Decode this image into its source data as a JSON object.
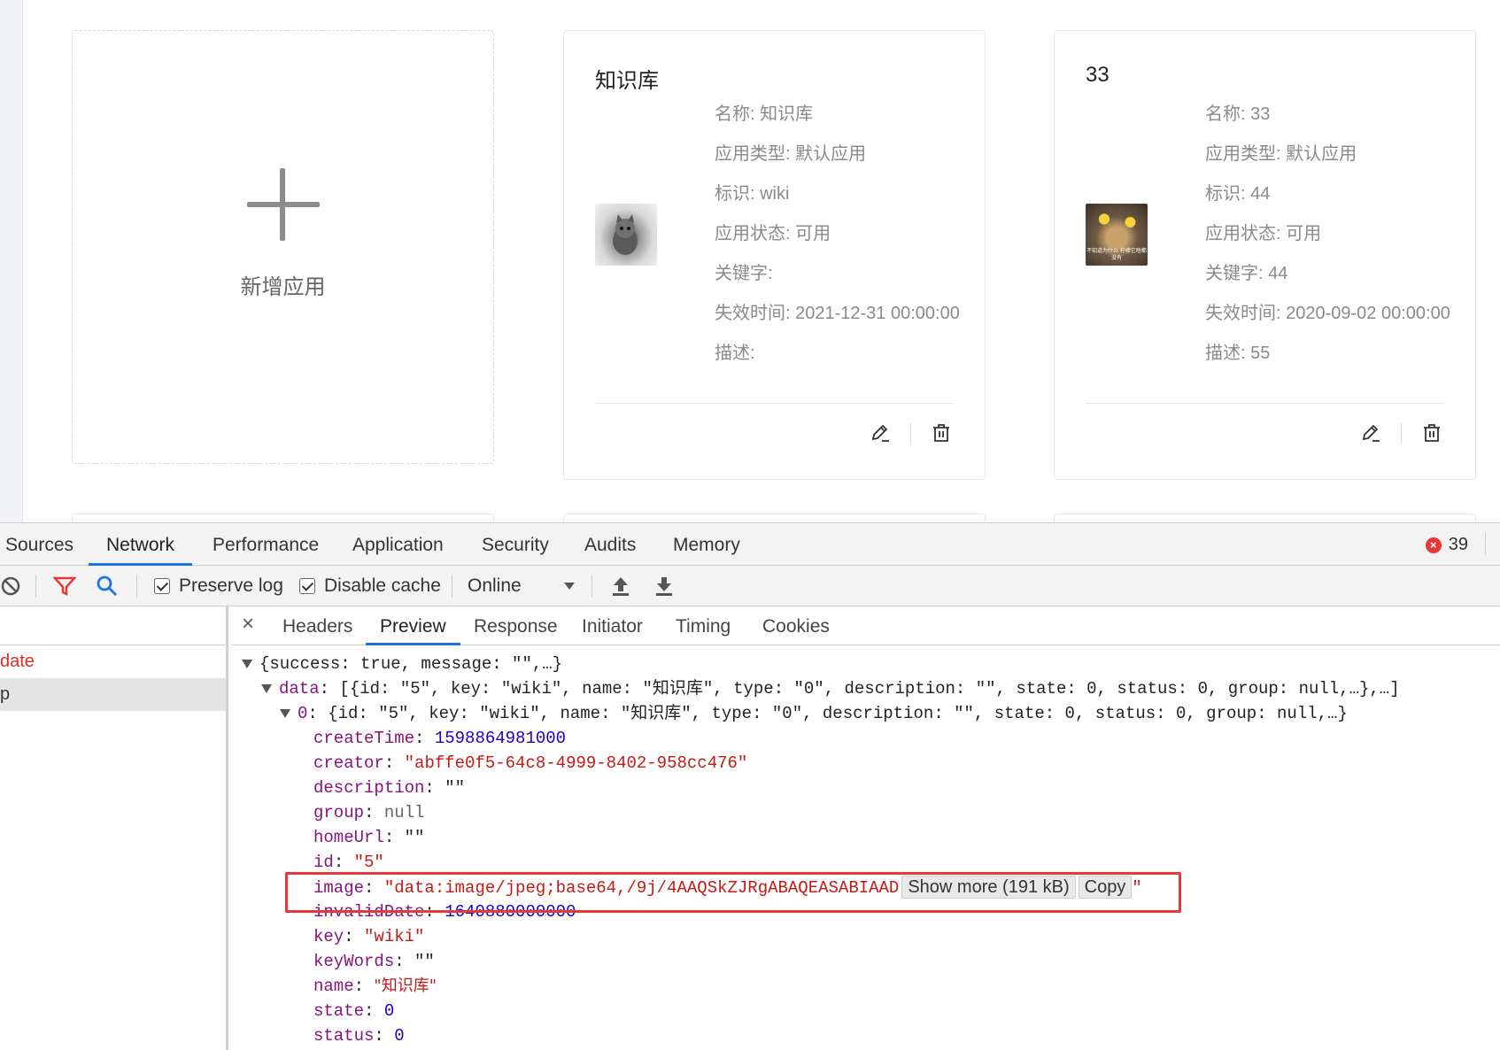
{
  "app": {
    "add_card": {
      "label": "新增应用"
    },
    "cards": [
      {
        "title": "知识库",
        "name": "名称: 知识库",
        "type": "应用类型: 默认应用",
        "key": "标识: wiki",
        "state": "应用状态: 可用",
        "keywords": "关键字:",
        "invalid_date": "失效时间: 2021-12-31 00:00:00",
        "description": "描述:",
        "image_icon": "kitten-photo"
      },
      {
        "title": "33",
        "name": "名称: 33",
        "type": "应用类型: 默认应用",
        "key": "标识: 44",
        "state": "应用状态: 可用",
        "keywords": "关键字: 44",
        "invalid_date": "失效时间: 2020-09-02 00:00:00",
        "description": "描述: 55",
        "image_icon": "meme-photo",
        "image_caption": "不知道为什么 柠檬它啥都没有"
      }
    ]
  },
  "devtools": {
    "tabs": [
      "Sources",
      "Network",
      "Performance",
      "Application",
      "Security",
      "Audits",
      "Memory"
    ],
    "active_tab": "Network",
    "error_count": "39",
    "toolbar": {
      "preserve_log": "Preserve log",
      "disable_cache": "Disable cache",
      "throttling": "Online"
    },
    "requests": [
      {
        "name": "date"
      },
      {
        "name": "p"
      }
    ],
    "detail_tabs": [
      "Headers",
      "Preview",
      "Response",
      "Initiator",
      "Timing",
      "Cookies"
    ],
    "active_detail_tab": "Preview",
    "preview": {
      "root": "{success: true, message: \"\",…}",
      "data_key": "data",
      "data_summary": "[{id: \"5\", key: \"wiki\", name: \"知识库\", type: \"0\", description: \"\", state: 0, status: 0, group: null,…},…]",
      "item_key": "0",
      "item_summary": "{id: \"5\", key: \"wiki\", name: \"知识库\", type: \"0\", description: \"\", state: 0, status: 0, group: null,…}",
      "fields": [
        {
          "key": "createTime",
          "value": "1598864981000",
          "kind": "number"
        },
        {
          "key": "creator",
          "value": "\"abffe0f5-64c8-4999-8402-958cc476\"",
          "kind": "string"
        },
        {
          "key": "description",
          "value": "\"\"",
          "kind": "plain"
        },
        {
          "key": "group",
          "value": "null",
          "kind": "null"
        },
        {
          "key": "homeUrl",
          "value": "\"\"",
          "kind": "plain"
        },
        {
          "key": "id",
          "value": "\"5\"",
          "kind": "string"
        },
        {
          "key": "image",
          "value": "\"data:image/jpeg;base64,/9j/4AAQSkZJRgABAQEASABIAAD",
          "kind": "string"
        },
        {
          "key": "invalidDate",
          "value": "1640880000000",
          "kind": "number"
        },
        {
          "key": "key",
          "value": "\"wiki\"",
          "kind": "string"
        },
        {
          "key": "keyWords",
          "value": "\"\"",
          "kind": "plain"
        },
        {
          "key": "name",
          "value": "\"知识库\"",
          "kind": "string"
        },
        {
          "key": "state",
          "value": "0",
          "kind": "number"
        },
        {
          "key": "status",
          "value": "0",
          "kind": "number"
        }
      ],
      "show_more": "Show more (191 kB)",
      "copy": "Copy",
      "closing_quote": "\""
    }
  }
}
